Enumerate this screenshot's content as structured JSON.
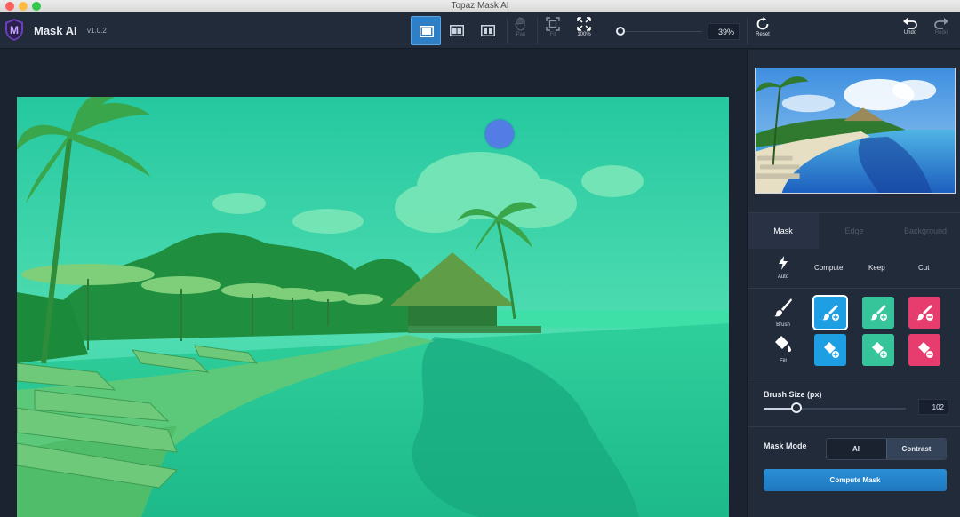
{
  "window": {
    "title": "Topaz Mask AI"
  },
  "app": {
    "name": "Mask AI",
    "version": "v1.0.2"
  },
  "toolbar": {
    "view_modes": [
      {
        "icon": "single-view-icon",
        "active": true
      },
      {
        "icon": "split-view-icon",
        "active": false
      },
      {
        "icon": "side-by-side-view-icon",
        "active": false
      }
    ],
    "pan_label": "Pan",
    "fit_label": "Fit",
    "zoom100_label": "100%",
    "zoom_value": "39%",
    "zoom_fraction": 0.39,
    "reset_label": "Reset",
    "undo_label": "Undo",
    "redo_label": "Redo"
  },
  "panel": {
    "tabs": [
      {
        "label": "Mask",
        "active": true
      },
      {
        "label": "Edge",
        "active": false
      },
      {
        "label": "Background",
        "active": false
      }
    ],
    "auto_label": "Auto",
    "columns": {
      "compute": "Compute",
      "keep": "Keep",
      "cut": "Cut"
    },
    "brush_label": "Brush",
    "fill_label": "Fill",
    "brush_size_label": "Brush Size (px)",
    "brush_size_value": "102",
    "mask_mode_label": "Mask Mode",
    "mask_modes": [
      {
        "label": "AI",
        "active": false
      },
      {
        "label": "Contrast",
        "active": true
      }
    ],
    "compute_mask_label": "Compute Mask"
  },
  "colors": {
    "accent": "#2e7fc6",
    "compute": "#1e9fe4",
    "keep": "#36c49a",
    "cut": "#e63d6e",
    "mask_overlay": "#2fd894"
  }
}
